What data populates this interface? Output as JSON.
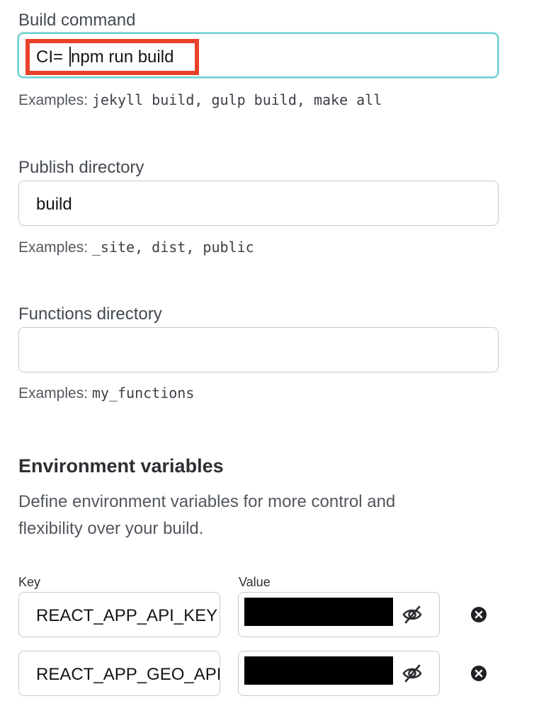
{
  "build": {
    "label": "Build command",
    "value_prefix": "CI=",
    "value_suffix": "npm run build",
    "hint_prefix": "Examples:",
    "hint_code": "jekyll build, gulp build, make all"
  },
  "publish": {
    "label": "Publish directory",
    "value": "build",
    "hint_prefix": "Examples:",
    "hint_code": "_site, dist, public"
  },
  "functions": {
    "label": "Functions directory",
    "value": "",
    "hint_prefix": "Examples:",
    "hint_code": "my_functions"
  },
  "env": {
    "title": "Environment variables",
    "description": "Define environment variables for more control and flexibility over your build.",
    "key_header": "Key",
    "value_header": "Value",
    "rows": [
      {
        "key": "REACT_APP_API_KEY",
        "value_hidden": true
      },
      {
        "key": "REACT_APP_GEO_API_KEY",
        "value_hidden": true
      }
    ]
  },
  "colors": {
    "highlight": "#e8412c",
    "focus": "#6fcfd0",
    "redaction": "#000000"
  },
  "icons": {
    "toggle_visibility": "eye-slash-icon",
    "remove": "close-circle-icon"
  }
}
